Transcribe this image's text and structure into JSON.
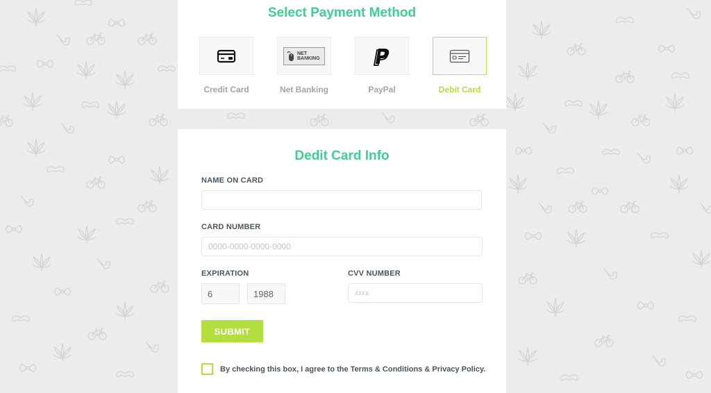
{
  "payment_section": {
    "title": "Select Payment Method",
    "methods": [
      {
        "label": "Credit Card",
        "icon": "credit-card-icon",
        "selected": false
      },
      {
        "label": "Net Banking",
        "icon": "net-banking-icon",
        "icon_text": [
          "NET",
          "BANKING"
        ],
        "selected": false
      },
      {
        "label": "PayPal",
        "icon": "paypal-icon",
        "selected": false
      },
      {
        "label": "Debit Card",
        "icon": "debit-card-icon",
        "selected": true
      }
    ]
  },
  "form": {
    "title": "Dedit Card Info",
    "name_label": "NAME ON CARD",
    "name_value": "",
    "card_number_label": "CARD NUMBER",
    "card_number_placeholder": "0000-0000-0000-0000",
    "expiration_label": "EXPIRATION",
    "exp_month": "6",
    "exp_year": "1988",
    "cvv_label": "CVV NUMBER",
    "cvv_placeholder": "xxxx",
    "submit_label": "SUBMIT",
    "agree_text": "By checking this box, I agree to the Terms & Conditions & Privacy Policy.",
    "agree_checked": false
  },
  "colors": {
    "title": "#3fcf8e",
    "accent": "#b2df3f",
    "background": "#ececec"
  }
}
